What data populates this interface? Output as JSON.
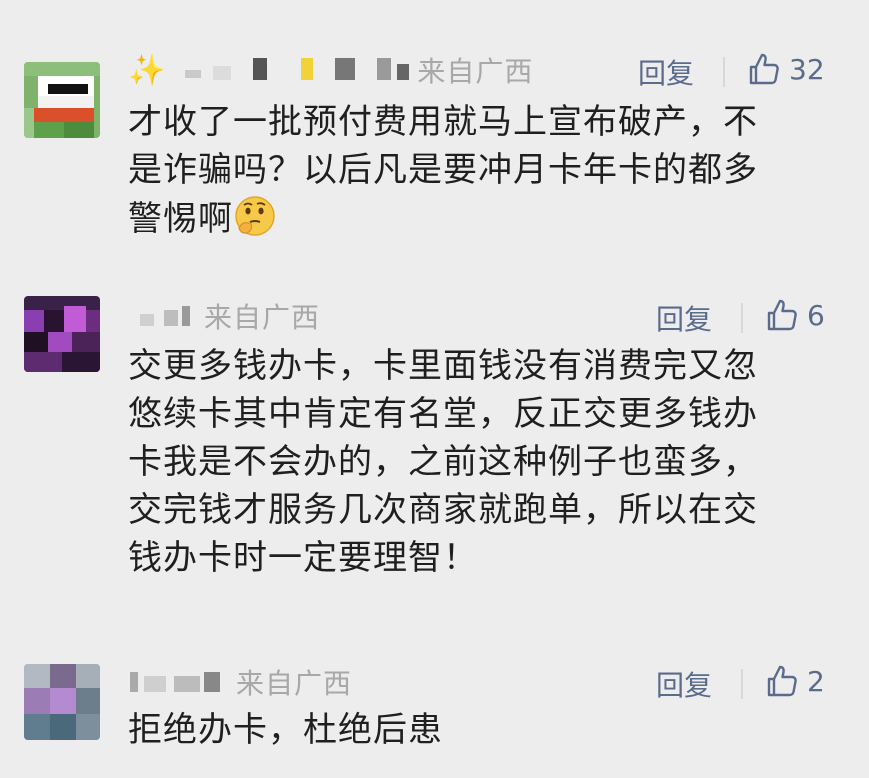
{
  "comments": [
    {
      "location": "来自广西",
      "reply_label": "回复",
      "likes": "32",
      "body_lines": [
        "才收了一批预付费用就马上宣布破产，不",
        "是诈骗吗？以后凡是要冲月卡年卡的都多",
        "警惕啊"
      ],
      "emoji": "thinking-face-emoji",
      "sparkle_icon": "sparkles-icon"
    },
    {
      "location": "来自广西",
      "reply_label": "回复",
      "likes": "6",
      "body_lines": [
        "交更多钱办卡，卡里面钱没有消费完又忽",
        "悠续卡其中肯定有名堂，反正交更多钱办",
        "卡我是不会办的，之前这种例子也蛮多，",
        "交完钱才服务几次商家就跑单，所以在交",
        "钱办卡时一定要理智！"
      ]
    },
    {
      "location": "来自广西",
      "reply_label": "回复",
      "likes": "2",
      "body_lines": [
        "拒绝办卡，杜绝后患"
      ]
    }
  ],
  "colors": {
    "background": "#ededed",
    "link": "#5a6b8c",
    "meta_gray": "#a8a8a8",
    "text": "#1f1f1f"
  }
}
